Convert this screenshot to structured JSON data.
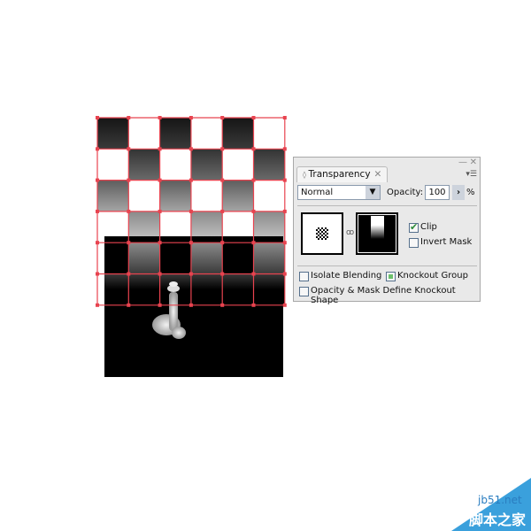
{
  "panel": {
    "title": "Transparency",
    "blend_mode": "Normal",
    "opacity_label": "Opacity:",
    "opacity_value": "100",
    "percent": "%",
    "clip": {
      "label": "Clip",
      "checked": true
    },
    "invert_mask": {
      "label": "Invert Mask",
      "checked": false
    },
    "isolate_blending": {
      "label": "Isolate Blending",
      "checked": false
    },
    "knockout_group": {
      "label": "Knockout Group",
      "checked": "mixed"
    },
    "opacity_mask_knockout": {
      "label": "Opacity & Mask Define Knockout Shape",
      "checked": false
    }
  },
  "watermark": {
    "site": "jb51.net",
    "name": "脚本之家"
  },
  "colors": {
    "selection": "#e8434f",
    "accent_check": "#2e8b3a",
    "knockout_fill": "#6cc06c",
    "watermark_blue": "#3aa0dc"
  }
}
